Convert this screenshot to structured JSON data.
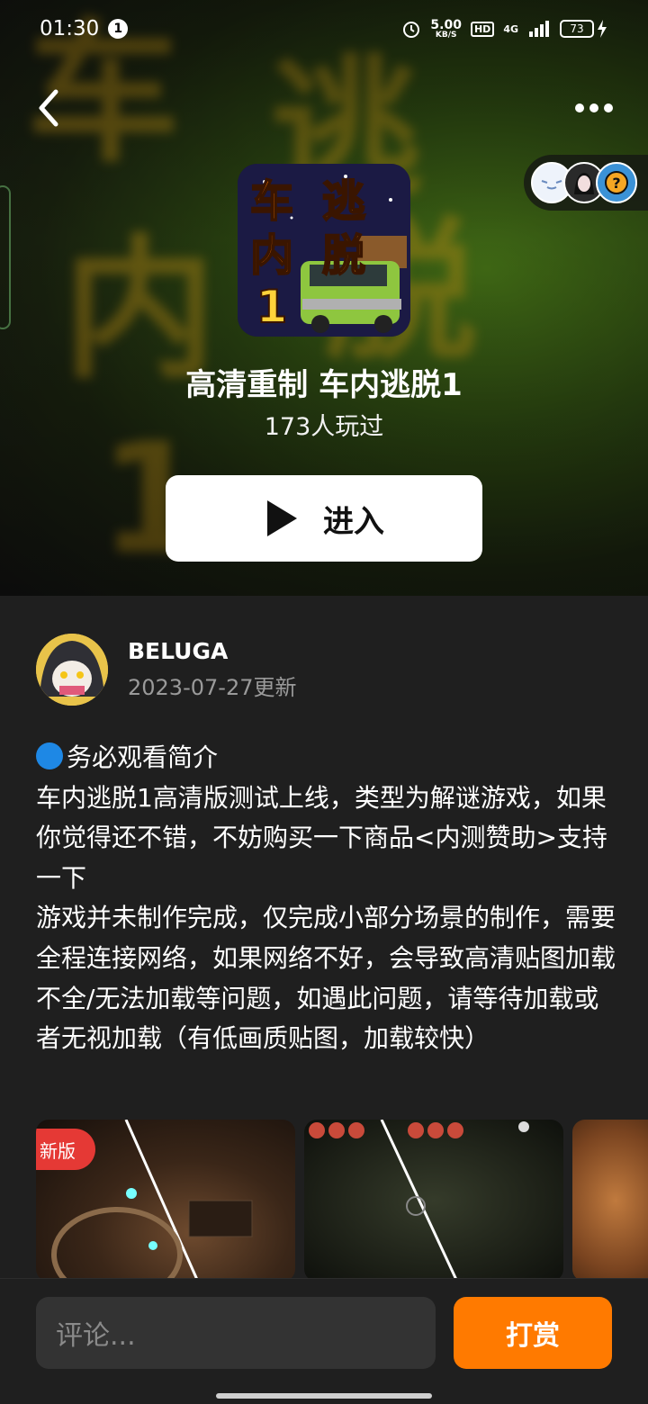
{
  "status_bar": {
    "time": "01:30",
    "notification_count": "1",
    "net_speed_value": "5.00",
    "net_speed_unit": "KB/S",
    "hd": "HD",
    "signal": "4G",
    "battery": "73"
  },
  "hero": {
    "background_chars": [
      "车",
      "逃",
      "内",
      "脱",
      "1"
    ],
    "icon_text": [
      "车",
      "逃",
      "内",
      "脱",
      "1"
    ],
    "title": "高清重制 车内逃脱1",
    "play_count": "173人玩过",
    "enter_label": "进入",
    "colors": {
      "accent_orange": "#ff7a00",
      "title_yellow": "#f5a623",
      "car_green": "#8ec63f"
    }
  },
  "author": {
    "name": "BELUGA",
    "updated": "2023-07-27更新"
  },
  "description": {
    "lines": [
      "务必观看简介",
      "车内逃脱1高清版测试上线，类型为解谜游戏，如果你觉得还不错，不妨购买一下商品<内测赞助>支持一下",
      "游戏并未制作完成，仅完成小部分场景的制作，需要全程连接网络，如果网络不好，会导致高清贴图加载不全/无法加载等问题，如遇此问题，请等待加载或者无视加载（有低画质贴图，加载较快）"
    ]
  },
  "screenshots": {
    "badge": "新版"
  },
  "bottom_bar": {
    "comment_placeholder": "评论...",
    "tip_label": "打赏"
  }
}
